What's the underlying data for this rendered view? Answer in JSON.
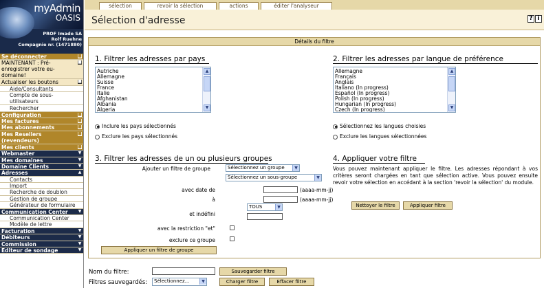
{
  "logo": {
    "line1": "myAdmin",
    "line2": "OASIS"
  },
  "profile": {
    "line1": "PROF Imade SA",
    "line2": "Rolf Ruehne",
    "line3": "Compagnie nr. (1471880)"
  },
  "sidebar": {
    "items": [
      {
        "label": "Se déconnecter",
        "style": "head-brown",
        "mark": "■"
      },
      {
        "label": "MAINTENANT : Pré-enregistrer votre eu-domaine!",
        "style": "head-light",
        "mark": "■",
        "multi": true
      },
      {
        "label": "Actualiser les boutons",
        "style": "head-light",
        "mark": "■"
      },
      {
        "label": "Aide/Consultants",
        "style": "sub"
      },
      {
        "label": "Compte de sous-utilisateurs",
        "style": "sub",
        "multi": true
      },
      {
        "label": "Rechercher",
        "style": "sub"
      },
      {
        "label": "Configuration",
        "style": "head-brown",
        "mark": "■"
      },
      {
        "label": "Mes factures",
        "style": "head-brown",
        "mark": "■"
      },
      {
        "label": "Mes abonnements",
        "style": "head-brown",
        "mark": "■"
      },
      {
        "label": "Mes Resellers (revendeurs)",
        "style": "head-brown",
        "mark": "■",
        "multi": true
      },
      {
        "label": "Mes clients",
        "style": "head-brown",
        "mark": "■"
      },
      {
        "label": "Webmaster",
        "style": "head-dark",
        "mark": "▼"
      },
      {
        "label": "Mes domaines",
        "style": "head-dark",
        "mark": "▼"
      },
      {
        "label": "Domaine Clients",
        "style": "head-dark",
        "mark": "▼"
      },
      {
        "label": "Adresses",
        "style": "head-dark",
        "mark": "▲"
      },
      {
        "label": "Contacts",
        "style": "sub"
      },
      {
        "label": "Import",
        "style": "sub"
      },
      {
        "label": "Recherche de doublon",
        "style": "sub"
      },
      {
        "label": "Gestion de groupe",
        "style": "sub"
      },
      {
        "label": "Générateur de formulaire",
        "style": "sub"
      },
      {
        "label": "Communication Center",
        "style": "head-dark",
        "mark": "▼"
      },
      {
        "label": "Communication Center",
        "style": "sub"
      },
      {
        "label": "Modèle de lettre",
        "style": "sub"
      },
      {
        "label": "Facturation",
        "style": "head-dark",
        "mark": "▼"
      },
      {
        "label": "Débiteurs",
        "style": "head-dark",
        "mark": "▼"
      },
      {
        "label": "Commission",
        "style": "head-dark",
        "mark": "▼"
      },
      {
        "label": "Editeur de sondage",
        "style": "head-dark",
        "mark": "▼"
      }
    ]
  },
  "tabs": [
    {
      "label": "sélection"
    },
    {
      "label": "revoir la sélection"
    },
    {
      "label": "actions"
    },
    {
      "label": "éditer l'analyseur"
    }
  ],
  "page_title": "Sélection d'adresse",
  "help_icons": {
    "question": "?",
    "info": "i"
  },
  "filter_header": "Détails du filtre",
  "section1": {
    "title": "1. Filtrer les adresses par pays",
    "options": [
      "Autriche",
      "Allemagne",
      "Suisse",
      "France",
      "Italie",
      "Afghanistan",
      "Albania",
      "Algeria"
    ],
    "include_label": "Inclure les pays sélectionnés",
    "exclude_label": "Exclure les pays sélectionnés"
  },
  "section2": {
    "title": "2. Filtrer les adresses par langue de préférence",
    "options": [
      "Allemagne",
      "Français",
      "Anglais",
      "Italiano (In progress)",
      "Español (In progress)",
      "Polish (In progress)",
      "Hungarian (In progress)",
      "Czech (In progress)"
    ],
    "include_label": "Sélectionnez les langues choisies",
    "exclude_label": "Exclure les langues sélectionnées"
  },
  "section3": {
    "title": "3. Filtrer les adresses de un ou plusieurs groupes",
    "add_group_label": "Ajouter un filtre de groupe",
    "group_select": "Sélectionnez un groupe",
    "subgroup_select": "Sélectionnez un sous-groupe",
    "date_label": "avec date de",
    "to_label": "à",
    "date_hint": "(aaaa-mm-jj)",
    "tous_select": "TOUS",
    "undefined_label": "et indéfini",
    "restriction_label": "avec la restriction \"et\"",
    "exclude_group_label": "exclure ce groupe",
    "apply_button": "Appliquer un filtre de groupe"
  },
  "section4": {
    "title": "4. Appliquer votre filtre",
    "text": "Vous pouvez maintenant appliquer le filtre. Les adresses répondant à vos critères seront chargées en tant que sélection active. Vous pouvez ensuite revoir votre sélection en accédant à la section 'revoir la sélection' du module.",
    "clear_button": "Nettoyer le filtre",
    "apply_button": "Appliquer filtre"
  },
  "bottom": {
    "name_label": "Nom du filtre:",
    "save_button": "Sauvegarder filtre",
    "saved_label": "Filtres sauvegardés:",
    "saved_select": "Sélectionnez...",
    "load_button": "Charger filtre",
    "delete_button": "Effacer filtre"
  }
}
